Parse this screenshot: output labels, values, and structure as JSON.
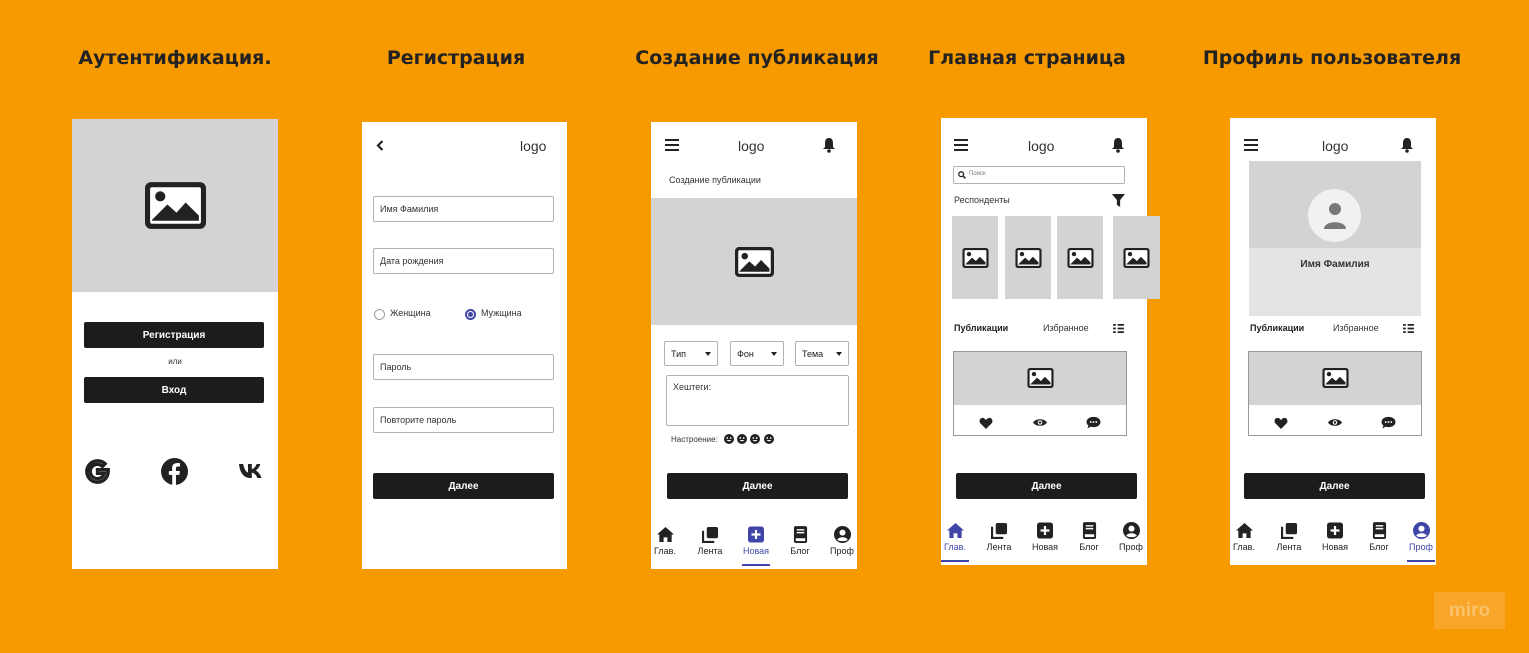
{
  "titles": {
    "auth": "Аутентификация.",
    "register": "Регистрация",
    "create": "Создание публикация",
    "home": "Главная страница",
    "profile": "Профиль пользователя"
  },
  "auth": {
    "register_button": "Регистрация",
    "or_text": "или",
    "login_button": "Вход",
    "social_icons": [
      "google-icon",
      "facebook-icon",
      "vk-icon"
    ]
  },
  "register": {
    "logo": "logo",
    "name_placeholder": "Имя Фамилия",
    "birth_placeholder": "Дата рождения",
    "gender_female": "Женщина",
    "gender_male": "Мужщина",
    "gender_selected": "Мужщина",
    "password_placeholder": "Пароль",
    "repeat_password_placeholder": "Повторите пароль",
    "next_button": "Далее"
  },
  "create": {
    "logo": "logo",
    "heading": "Создание публикации",
    "type_select": "Тип",
    "background_select": "Фон",
    "theme_select": "Тема",
    "hashtags_placeholder": "Хештеги:",
    "mood_label": "Настроение:",
    "next_button": "Далее"
  },
  "home": {
    "logo": "logo",
    "search_placeholder": "Поиск",
    "respondents_label": "Респонденты",
    "publications_tab": "Публикации",
    "favorites_tab": "Избранное",
    "next_button": "Далее"
  },
  "profile": {
    "logo": "logo",
    "user_name": "Имя Фамилия",
    "publications_tab": "Публикации",
    "favorites_tab": "Избранное",
    "next_button": "Далее"
  },
  "nav": {
    "home": "Глав.",
    "feed": "Лента",
    "new": "Новая",
    "blog": "Блог",
    "profile": "Проф"
  },
  "accent_color": "#3f46a8",
  "background_color": "#f79a00",
  "watermark": "miro"
}
